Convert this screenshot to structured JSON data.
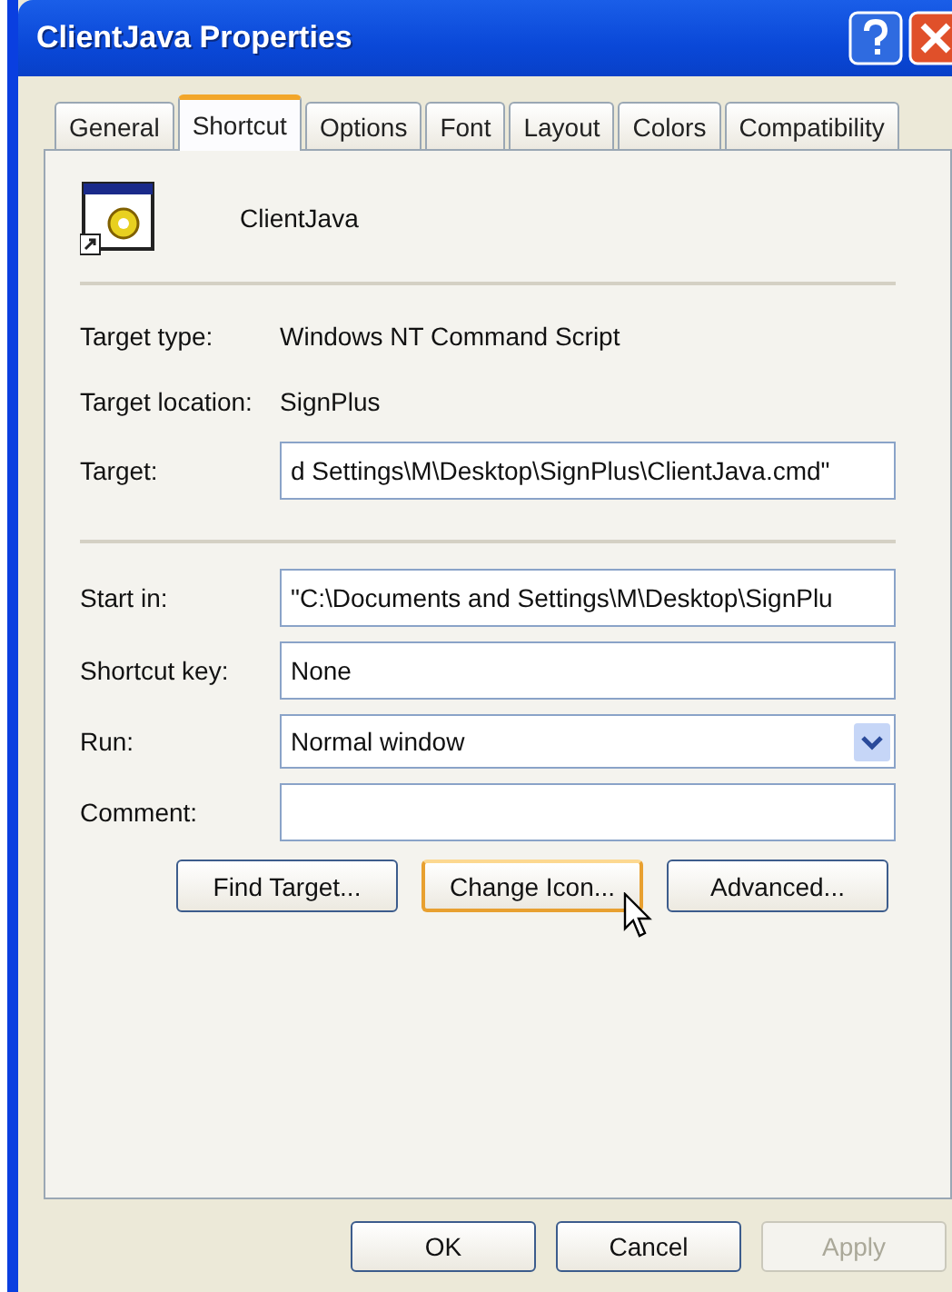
{
  "window": {
    "title": "ClientJava Properties"
  },
  "tabs": [
    {
      "label": "General",
      "selected": false
    },
    {
      "label": "Shortcut",
      "selected": true
    },
    {
      "label": "Options",
      "selected": false
    },
    {
      "label": "Font",
      "selected": false
    },
    {
      "label": "Layout",
      "selected": false
    },
    {
      "label": "Colors",
      "selected": false
    },
    {
      "label": "Compatibility",
      "selected": false
    }
  ],
  "shortcut": {
    "name": "ClientJava"
  },
  "info": [
    {
      "label": "Target type:",
      "value": "Windows NT Command Script"
    },
    {
      "label": "Target location:",
      "value": "SignPlus"
    }
  ],
  "target": {
    "label": "Target:",
    "value": "d Settings\\M\\Desktop\\SignPlus\\ClientJava.cmd\""
  },
  "fields": [
    {
      "kind": "text",
      "label": "Start in:",
      "value": "\"C:\\Documents and Settings\\M\\Desktop\\SignPlu"
    },
    {
      "kind": "text",
      "label": "Shortcut key:",
      "value": "None"
    },
    {
      "kind": "dropdown",
      "label": "Run:",
      "value": "Normal window"
    },
    {
      "kind": "text",
      "label": "Comment:"
    }
  ],
  "actions": [
    {
      "label": "Find Target...",
      "hovered": false
    },
    {
      "label": "Change Icon...",
      "hovered": true
    },
    {
      "label": "Advanced...",
      "hovered": false
    }
  ],
  "buttons": [
    {
      "label": "OK",
      "disabled": false
    },
    {
      "label": "Cancel",
      "disabled": false
    },
    {
      "label": "Apply",
      "disabled": true
    }
  ]
}
